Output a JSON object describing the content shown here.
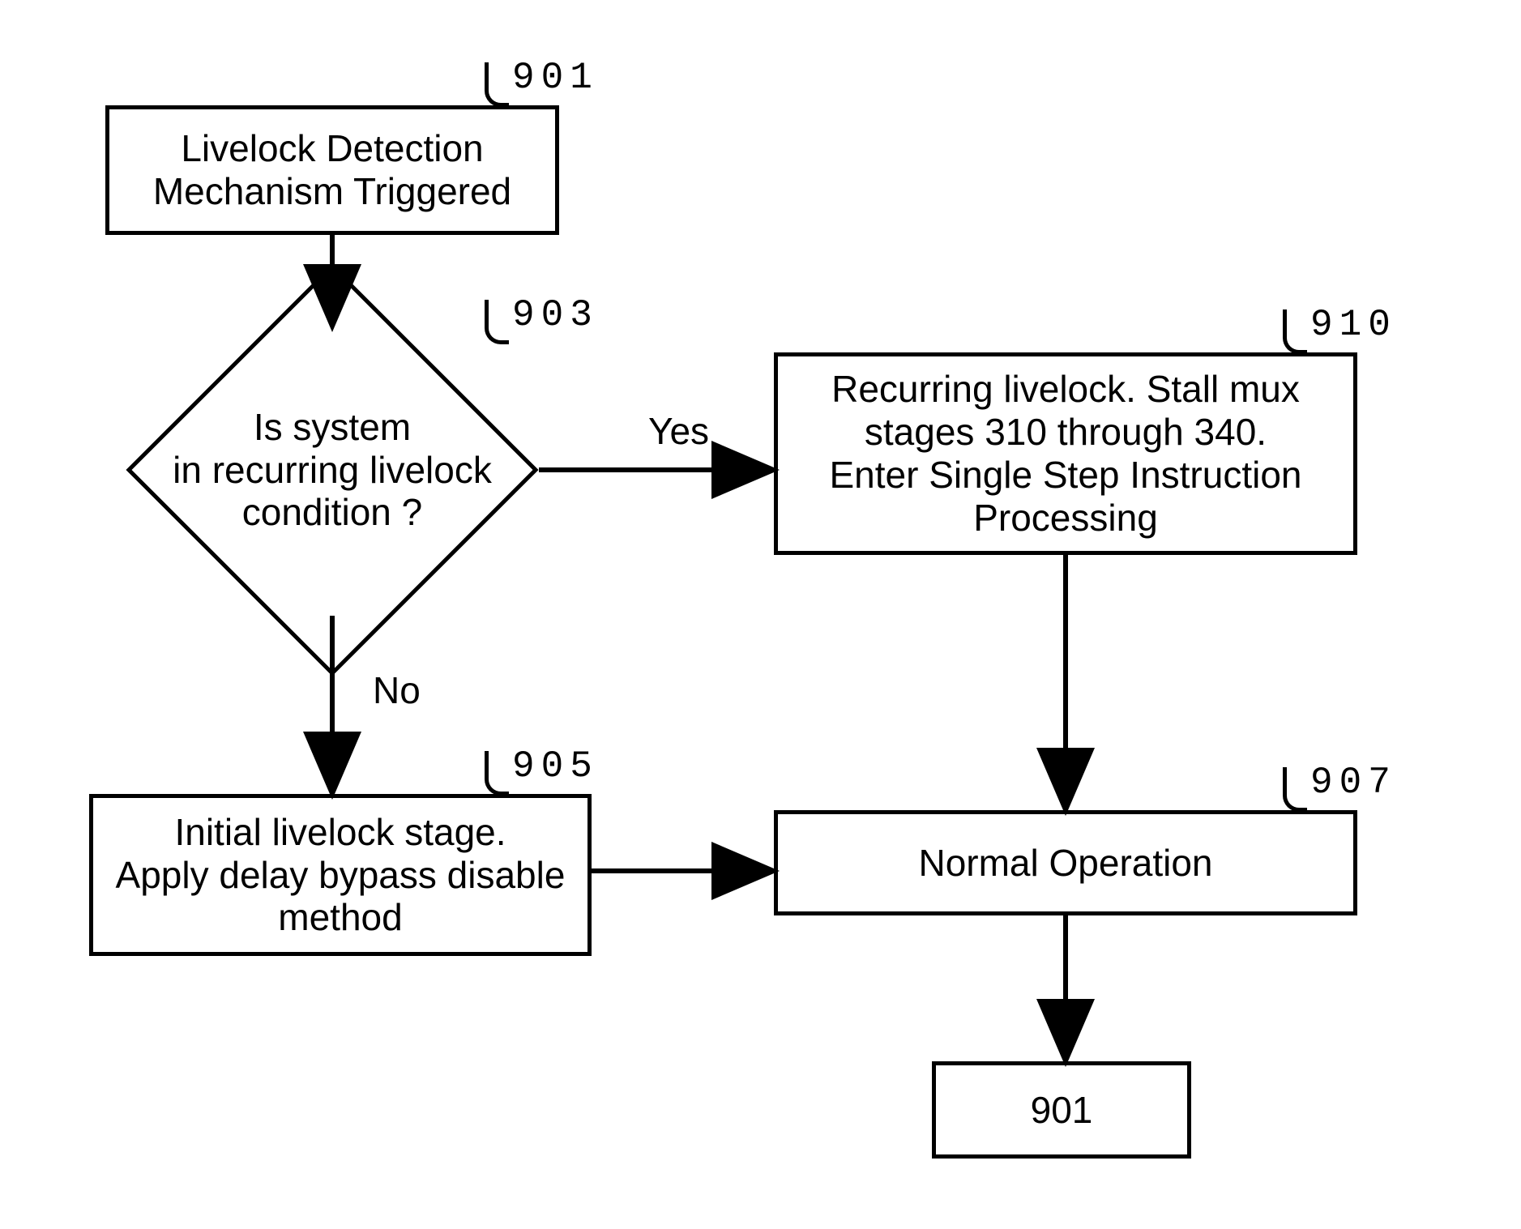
{
  "chart_data": {
    "type": "flowchart",
    "nodes": [
      {
        "id": "901",
        "type": "process",
        "text": "Livelock Detection Mechanism Triggered"
      },
      {
        "id": "903",
        "type": "decision",
        "text": "Is system in recurring livelock condition ?"
      },
      {
        "id": "905",
        "type": "process",
        "text": "Initial livelock stage. Apply delay bypass disable method"
      },
      {
        "id": "910",
        "type": "process",
        "text": "Recurring livelock. Stall mux stages 310 through 340. Enter Single Step Instruction Processing"
      },
      {
        "id": "907",
        "type": "process",
        "text": "Normal Operation"
      },
      {
        "id": "end901",
        "type": "terminal",
        "text": "901"
      }
    ],
    "edges": [
      {
        "from": "901",
        "to": "903",
        "label": ""
      },
      {
        "from": "903",
        "to": "910",
        "label": "Yes"
      },
      {
        "from": "903",
        "to": "905",
        "label": "No"
      },
      {
        "from": "905",
        "to": "907",
        "label": ""
      },
      {
        "from": "910",
        "to": "907",
        "label": ""
      },
      {
        "from": "907",
        "to": "end901",
        "label": ""
      }
    ]
  },
  "nodes": {
    "n901": {
      "label": "901",
      "text": "Livelock Detection\nMechanism Triggered"
    },
    "n903": {
      "label": "903",
      "text": "Is system\nin recurring livelock\ncondition ?"
    },
    "n905": {
      "label": "905",
      "text": "Initial livelock stage.\nApply delay bypass disable\nmethod"
    },
    "n910": {
      "label": "910",
      "text": "Recurring livelock. Stall mux\nstages 310 through 340.\nEnter Single Step Instruction\nProcessing"
    },
    "n907": {
      "label": "907",
      "text": "Normal Operation"
    },
    "nend": {
      "text": "901"
    }
  },
  "edge_labels": {
    "yes": "Yes",
    "no": "No"
  }
}
